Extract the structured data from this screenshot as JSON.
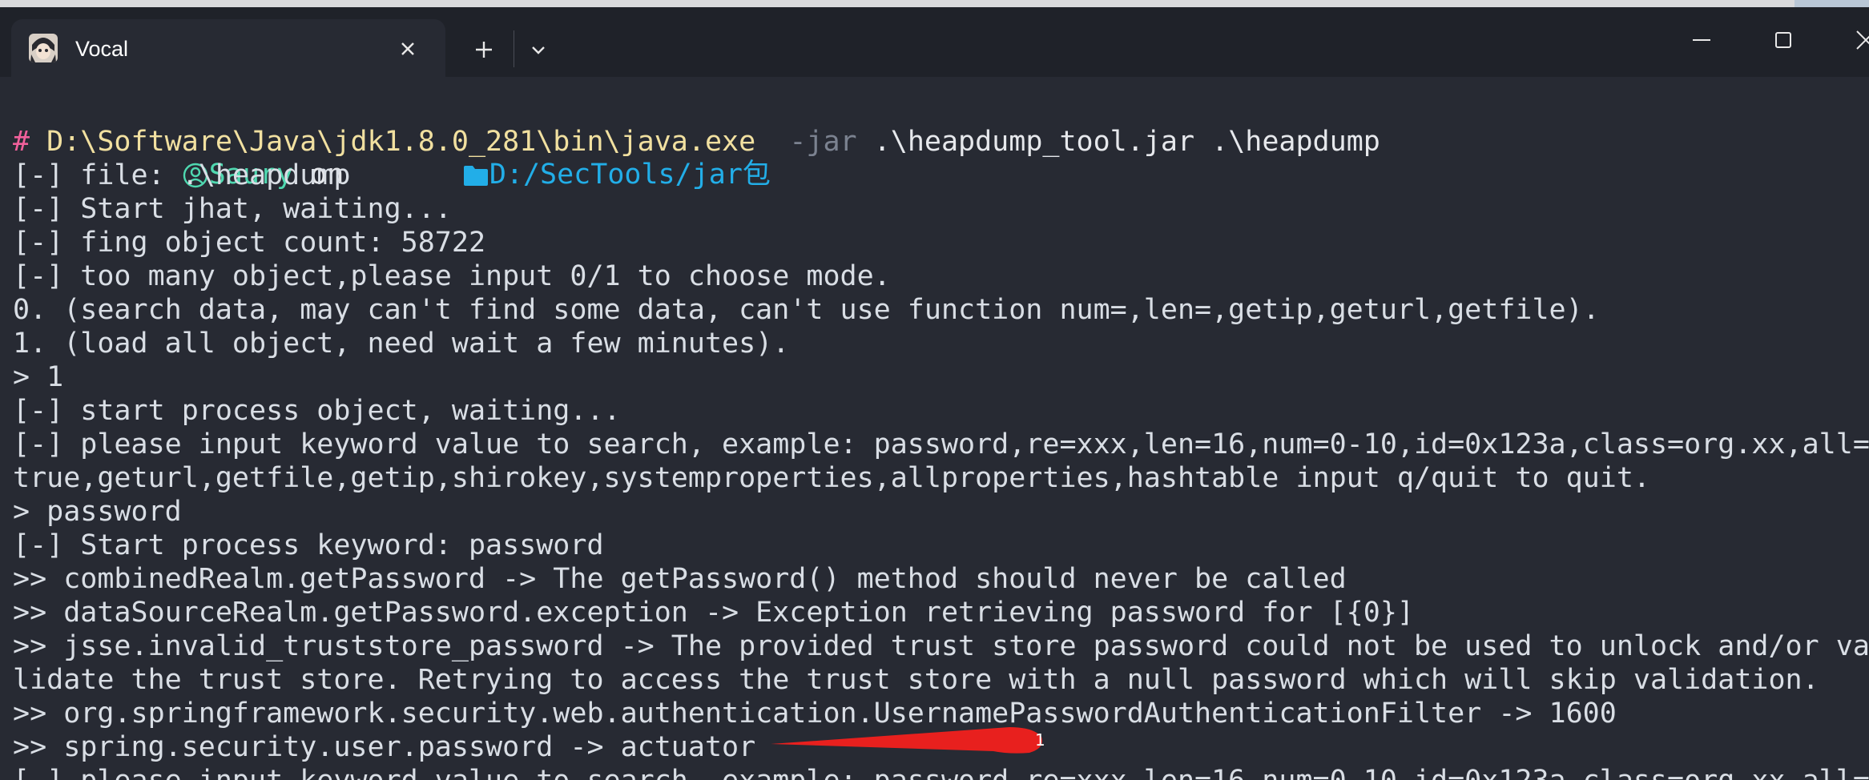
{
  "window": {
    "tab_title": "Vocal"
  },
  "prompt": {
    "user": "Saury",
    "on": " on ",
    "path": "D:/SecTools/jar包"
  },
  "command": {
    "hash": "#",
    "exe": " D:\\Software\\Java\\jdk1.8.0_281\\bin\\java.exe",
    "flag": "  -jar",
    "args": " .\\heapdump_tool.jar .\\heapdump"
  },
  "output_lines": [
    "[-] file: .\\heapdump",
    "[-] Start jhat, waiting...",
    "[-] fing object count: 58722",
    "[-] too many object,please input 0/1 to choose mode.",
    "0. (search data, may can't find some data, can't use function num=,len=,getip,geturl,getfile).",
    "1. (load all object, need wait a few minutes).",
    "> 1",
    "[-] start process object, waiting...",
    "[-] please input keyword value to search, example: password,re=xxx,len=16,num=0-10,id=0x123a,class=org.xx,all=",
    "true,geturl,getfile,getip,shirokey,systemproperties,allproperties,hashtable input q/quit to quit.",
    "> password",
    "[-] Start process keyword: password",
    ">> combinedRealm.getPassword -> The getPassword() method should never be called",
    ">> dataSourceRealm.getPassword.exception -> Exception retrieving password for [{0}]",
    ">> jsse.invalid_truststore_password -> The provided trust store password could not be used to unlock and/or va",
    "lidate the trust store. Retrying to access the trust store with a null password which will skip validation.",
    ">> org.springframework.security.web.authentication.UsernamePasswordAuthenticationFilter -> 1600",
    ">> spring.security.user.password -> actuator",
    "[-] please input keyword value to search, example: password,re=xxx,len=16,num=0-10,id=0x123a,class=org.xx,all="
  ],
  "annotation": {
    "label": "1",
    "color": "#e8201e"
  },
  "colors": {
    "background": "#272a33",
    "titlebar": "#1f2229",
    "text": "#d9dee5",
    "prompt_user": "#4fd8b0",
    "prompt_path": "#22aee8",
    "hash": "#f0609b",
    "exe": "#f1e0a0",
    "flag": "#7b8290"
  },
  "icons": [
    "avatar-icon",
    "close-icon",
    "plus-icon",
    "chevron-down-icon",
    "minimize-icon",
    "maximize-icon",
    "user-circle-icon",
    "folder-icon"
  ]
}
